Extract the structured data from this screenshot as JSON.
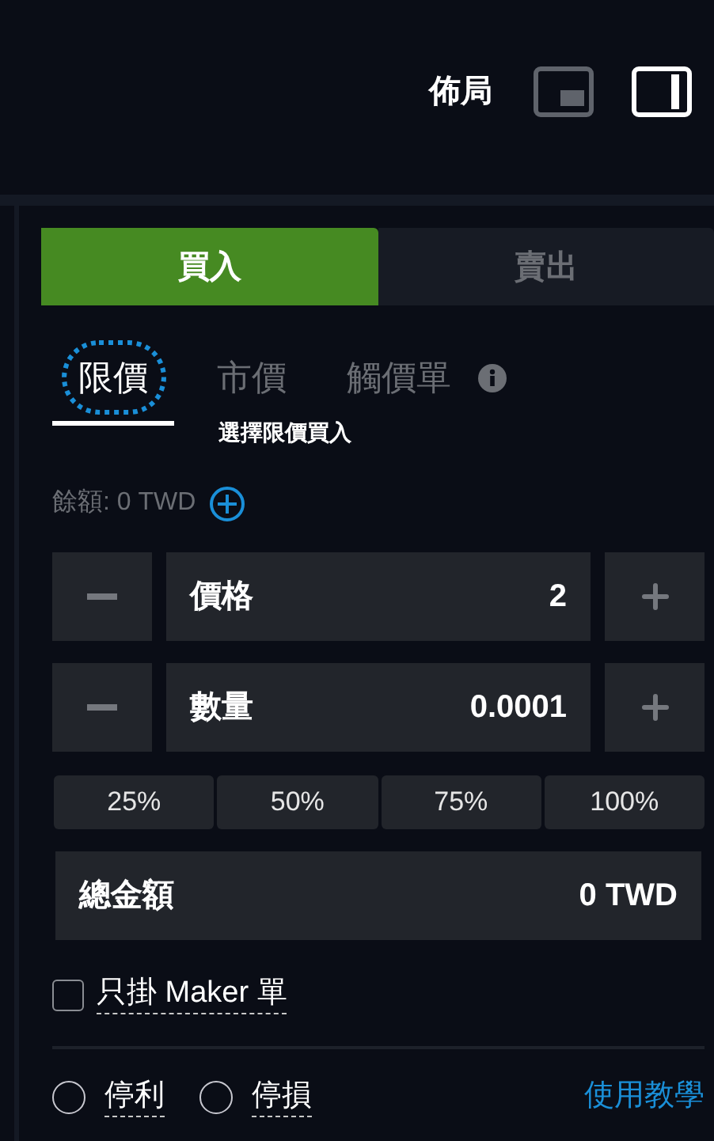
{
  "header": {
    "title": "佈局",
    "layouts": [
      {
        "kind": "pip",
        "selected": false
      },
      {
        "kind": "sidebar",
        "selected": true
      }
    ]
  },
  "side_tabs": [
    {
      "label": "買入",
      "selected": true
    },
    {
      "label": "賣出",
      "selected": false
    }
  ],
  "order_types": [
    {
      "label": "限價",
      "selected": true,
      "focused": true,
      "info": false
    },
    {
      "label": "市價",
      "selected": false,
      "focused": false,
      "info": false
    },
    {
      "label": "觸價單",
      "selected": false,
      "focused": false,
      "info": true
    }
  ],
  "order_hint": "選擇限價買入",
  "balance": "餘額: 0 TWD",
  "inputs": [
    {
      "label": "價格",
      "value": "2"
    },
    {
      "label": "數量",
      "value": "0.0001"
    }
  ],
  "percentages": [
    "25%",
    "50%",
    "75%",
    "100%"
  ],
  "total": {
    "label": "總金額",
    "value": "0 TWD"
  },
  "maker_only": {
    "label": "只掛 Maker 單",
    "checked": false
  },
  "stops": [
    {
      "label": "停利",
      "selected": false
    },
    {
      "label": "停損",
      "selected": false
    }
  ],
  "tutorial_link": "使用教學"
}
